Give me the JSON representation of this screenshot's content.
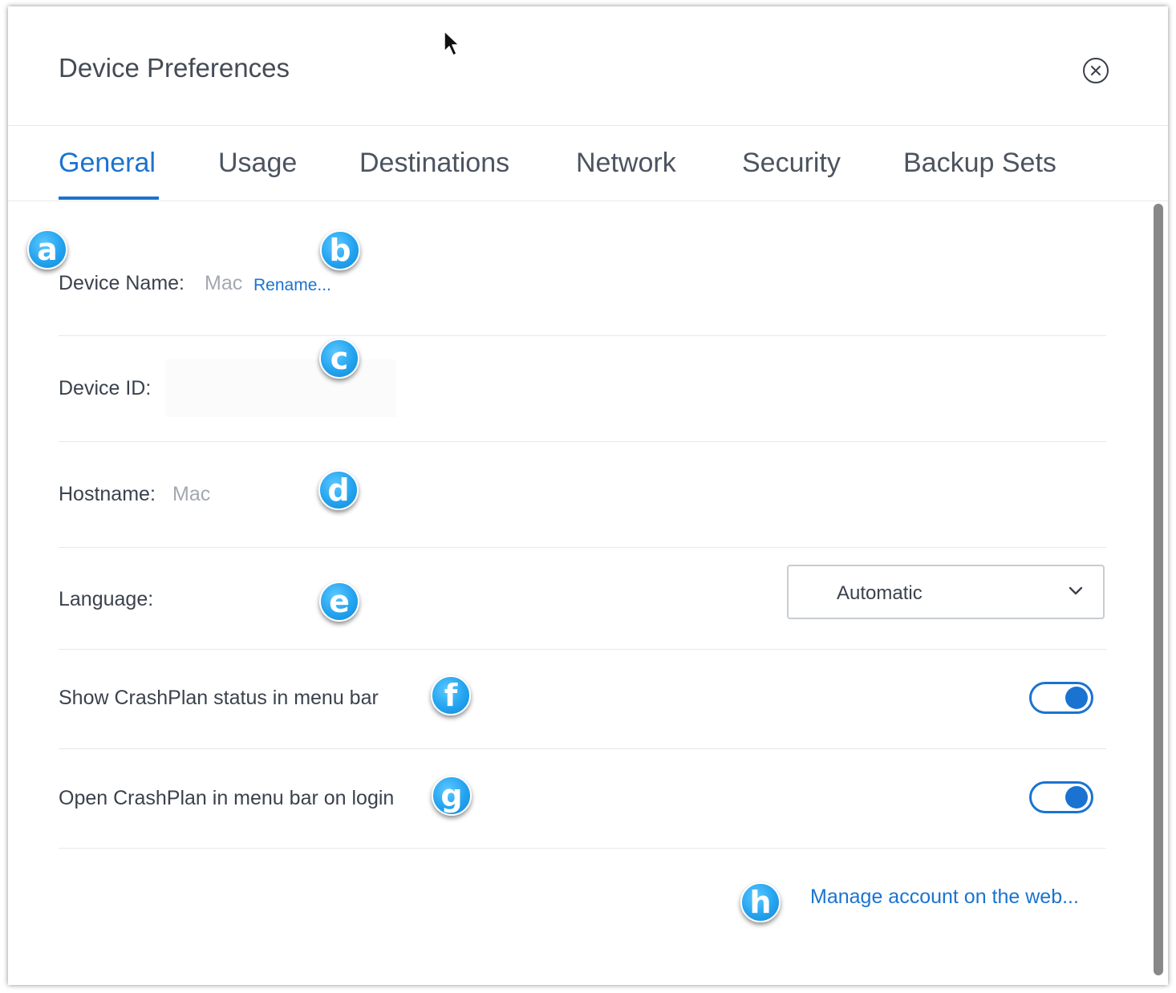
{
  "window": {
    "title": "Device Preferences",
    "close_icon": "close-circle-icon"
  },
  "tabs": [
    {
      "label": "General",
      "active": true
    },
    {
      "label": "Usage",
      "active": false
    },
    {
      "label": "Destinations",
      "active": false
    },
    {
      "label": "Network",
      "active": false
    },
    {
      "label": "Security",
      "active": false
    },
    {
      "label": "Backup Sets",
      "active": false
    }
  ],
  "general": {
    "device_name": {
      "label": "Device Name:",
      "value": "Mac",
      "rename_link": "Rename..."
    },
    "device_id": {
      "label": "Device ID:",
      "value": ""
    },
    "hostname": {
      "label": "Hostname:",
      "value": "Mac"
    },
    "language": {
      "label": "Language:",
      "selected": "Automatic"
    },
    "show_status": {
      "label": "Show CrashPlan status in menu bar",
      "enabled": true
    },
    "open_on_login": {
      "label": "Open CrashPlan in menu bar on login",
      "enabled": true
    },
    "manage_link": "Manage account on the web..."
  },
  "callouts": [
    "a",
    "b",
    "c",
    "d",
    "e",
    "f",
    "g",
    "h"
  ],
  "colors": {
    "accent": "#1a73d0",
    "callout": "#23a3ef"
  }
}
